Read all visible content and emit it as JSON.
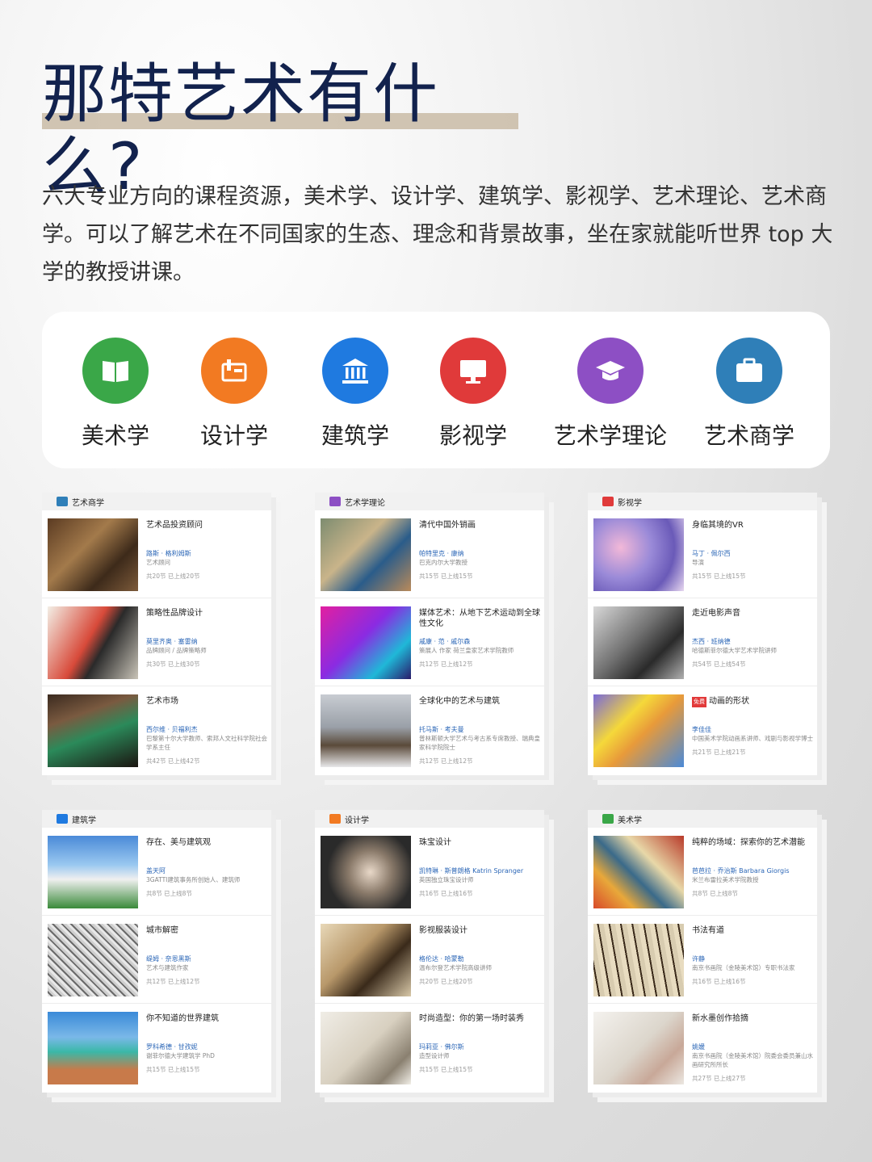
{
  "title": "那特艺术有什么?",
  "intro": "六大专业方向的课程资源，美术学、设计学、建筑学、影视学、艺术理论、艺术商学。可以了解艺术在不同国家的生态、理念和背景故事，坐在家就能听世界 top 大学的教授讲课。",
  "categories": [
    {
      "label": "美术学",
      "icon": "book-icon",
      "color": "#3aa748"
    },
    {
      "label": "设计学",
      "icon": "design-tool-icon",
      "color": "#f27a22"
    },
    {
      "label": "建筑学",
      "icon": "bank-building-icon",
      "color": "#1f7ae0"
    },
    {
      "label": "影视学",
      "icon": "monitor-icon",
      "color": "#e03a3a"
    },
    {
      "label": "艺术学理论",
      "icon": "graduation-cap-icon",
      "color": "#8d4fc4"
    },
    {
      "label": "艺术商学",
      "icon": "briefcase-icon",
      "color": "#2f7fb8"
    }
  ],
  "cards": [
    {
      "header": "艺术商学",
      "color": "#2f7fb8",
      "courses": [
        {
          "title": "艺术品投资顾问",
          "teacher": "路斯 · 格利姆斯",
          "role": "艺术顾问",
          "lessons": "共20节 已上线20节",
          "tag": ""
        },
        {
          "title": "策略性品牌设计",
          "teacher": "莫里齐奥 · 塞雷纳",
          "role": "品牌顾问 / 品牌策略师",
          "lessons": "共30节 已上线30节",
          "tag": ""
        },
        {
          "title": "艺术市场",
          "teacher": "西尔维 · 贝福利杰",
          "role": "巴黎第十尔大学教师、索邦人文社科学院社会学系主任",
          "lessons": "共42节 已上线42节",
          "tag": ""
        }
      ]
    },
    {
      "header": "艺术学理论",
      "color": "#8d4fc4",
      "courses": [
        {
          "title": "清代中国外销画",
          "teacher": "帕特里克 · 康纳",
          "role": "巴克内尔大学教授",
          "lessons": "共15节 已上线15节",
          "tag": ""
        },
        {
          "title": "媒体艺术：从地下艺术运动到全球性文化",
          "teacher": "戚康 · 范 · 戚尔森",
          "role": "策展人 作家 荷兰皇家艺术学院教师",
          "lessons": "共12节 已上线12节",
          "tag": ""
        },
        {
          "title": "全球化中的艺术与建筑",
          "teacher": "托马斯 · 考夫曼",
          "role": "普林斯顿大学艺术与考古系专席教授、瑞典皇家科学院院士",
          "lessons": "共12节 已上线12节",
          "tag": ""
        }
      ]
    },
    {
      "header": "影视学",
      "color": "#e03a3a",
      "courses": [
        {
          "title": "身临其境的VR",
          "teacher": "马丁 · 佩尔西",
          "role": "导演",
          "lessons": "共15节 已上线15节",
          "tag": ""
        },
        {
          "title": "走近电影声音",
          "teacher": "杰西 · 班纳德",
          "role": "哈德斯菲尔德大学艺术学院讲师",
          "lessons": "共54节 已上线54节",
          "tag": ""
        },
        {
          "title": "动画的形状",
          "teacher": "李佳佳",
          "role": "中国美术学院动画系讲师、戏剧与影视学博士",
          "lessons": "共21节 已上线21节",
          "tag": "免费"
        }
      ]
    },
    {
      "header": "建筑学",
      "color": "#1f7ae0",
      "courses": [
        {
          "title": "存在、美与建筑观",
          "teacher": "盖天阿",
          "role": "3GATTI建筑事务所创始人、建筑师",
          "lessons": "共8节 已上线8节",
          "tag": ""
        },
        {
          "title": "城市解密",
          "teacher": "缇姆 · 奈恩黑斯",
          "role": "艺术与建筑作家",
          "lessons": "共12节 已上线12节",
          "tag": ""
        },
        {
          "title": "你不知道的世界建筑",
          "teacher": "罗科希德 · 甘孜妮",
          "role": "谢菲尔德大学建筑学 PhD",
          "lessons": "共15节 已上线15节",
          "tag": ""
        }
      ]
    },
    {
      "header": "设计学",
      "color": "#f27a22",
      "courses": [
        {
          "title": "珠宝设计",
          "teacher": "凯特琳 · 斯普朗格 Katrin Spranger",
          "role": "英国独立珠宝设计师",
          "lessons": "共16节 已上线16节",
          "tag": ""
        },
        {
          "title": "影视服装设计",
          "teacher": "格伦达 · 哈蒙勒",
          "role": "温布尔登艺术学院高级讲师",
          "lessons": "共20节 已上线20节",
          "tag": ""
        },
        {
          "title": "时尚造型：你的第一场时装秀",
          "teacher": "玛莉亚 · 佛尔斯",
          "role": "造型设计师",
          "lessons": "共15节 已上线15节",
          "tag": ""
        }
      ]
    },
    {
      "header": "美术学",
      "color": "#3aa748",
      "courses": [
        {
          "title": "纯粹的场域：探索你的艺术潜能",
          "teacher": "芭芭拉 · 乔治斯 Barbara Giorgis",
          "role": "米兰布雷拉美术学院教授",
          "lessons": "共8节 已上线8节",
          "tag": ""
        },
        {
          "title": "书法有道",
          "teacher": "许静",
          "role": "南京书画院（金陵美术馆）专职书法家",
          "lessons": "共16节 已上线16节",
          "tag": ""
        },
        {
          "title": "新水墨创作拾摘",
          "teacher": "姚媛",
          "role": "南京书画院（金陵美术馆）院委会委员兼山水画研究所所长",
          "lessons": "共27节 已上线27节",
          "tag": ""
        }
      ]
    }
  ]
}
